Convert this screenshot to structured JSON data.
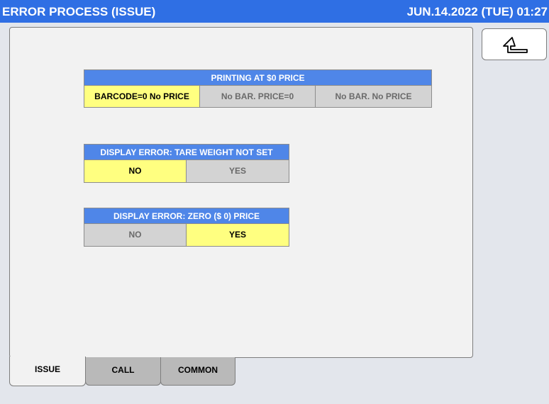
{
  "header": {
    "title": "ERROR PROCESS (ISSUE)",
    "datetime": "JUN.14.2022 (TUE) 01:27",
    "bg_color": "#2f6fe4"
  },
  "back_button": {
    "icon": "return-arrow-icon"
  },
  "settings": [
    {
      "heading": "PRINTING AT $0 PRICE",
      "options": [
        "BARCODE=0 No PRICE",
        "No BAR. PRICE=0",
        "No BAR. No PRICE"
      ],
      "selected": "BARCODE=0 No PRICE"
    },
    {
      "heading": "DISPLAY ERROR: TARE WEIGHT NOT SET",
      "options": [
        "NO",
        "YES"
      ],
      "selected": "NO"
    },
    {
      "heading": "DISPLAY ERROR: ZERO ($ 0) PRICE",
      "options": [
        "NO",
        "YES"
      ],
      "selected": "YES"
    }
  ],
  "tabs": [
    {
      "label": "ISSUE",
      "active": true
    },
    {
      "label": "CALL",
      "active": false
    },
    {
      "label": "COMMON",
      "active": false
    }
  ],
  "colors": {
    "selected_option": "#ffff80",
    "unselected_option": "#d3d3d3",
    "group_header": "#4f86e8"
  }
}
